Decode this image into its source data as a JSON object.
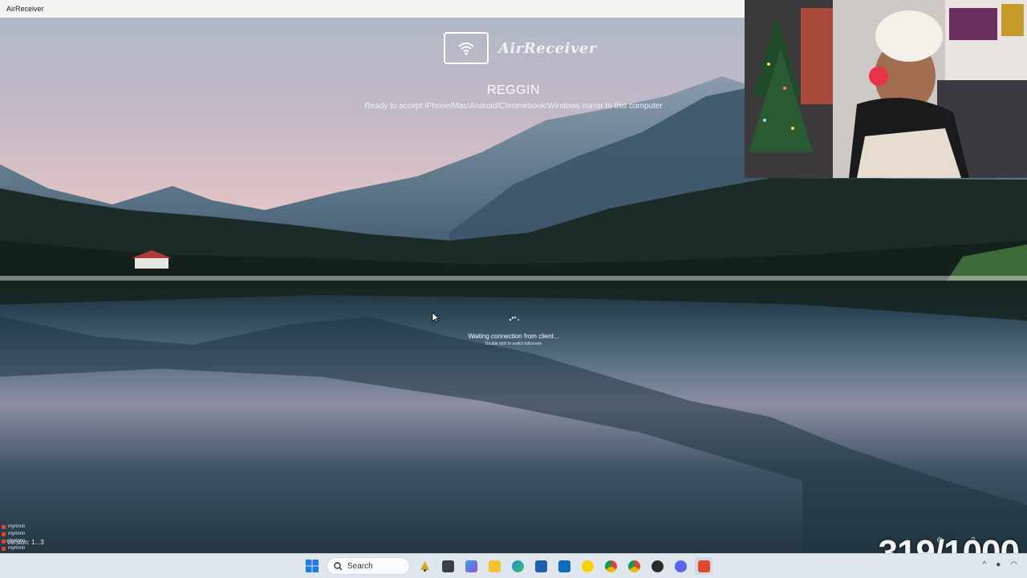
{
  "window": {
    "title": "AirReceiver"
  },
  "airreceiver": {
    "brand": "AirReceiver",
    "device_name": "REGGIN",
    "ready_text": "Ready to accept iPhone/Mac/Android/Chromebook/Windows mirror to this computer",
    "waiting_text": "Waiting connection from client...",
    "hint_text": "Double click to switch fullscreen",
    "version_text": "Version: 1...3"
  },
  "stream": {
    "counter": "319/1000",
    "chat": [
      {
        "user": "myrinnn"
      },
      {
        "user": "myrinnn"
      },
      {
        "user": "myrinnn"
      },
      {
        "user": "myrinnn"
      }
    ]
  },
  "taskbar": {
    "search_placeholder": "Search",
    "apps": [
      "start-icon",
      "search-icon",
      "pinned-app-icon",
      "task-view-icon",
      "store-icon",
      "file-explorer-icon",
      "edge-icon",
      "calculator-icon",
      "outlook-icon",
      "norton-icon",
      "chrome-icon",
      "chrome-alt-icon",
      "obs-icon",
      "discord-icon",
      "airreceiver-icon"
    ]
  },
  "colors": {
    "taskbar_bg": "#dfe6ee",
    "accent_windows": "#1f7be8",
    "lake_top": "#2a4656"
  }
}
